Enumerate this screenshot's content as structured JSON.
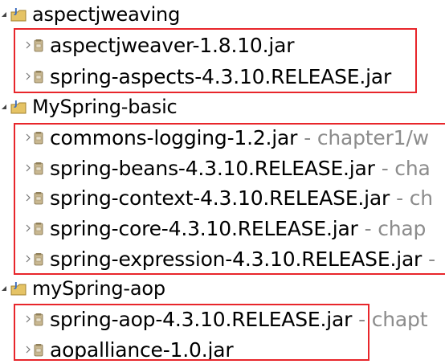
{
  "projects": [
    {
      "name": "aspectjweaving",
      "jars": [
        {
          "name": "aspectjweaver-1.8.10.jar",
          "decoration": ""
        },
        {
          "name": "spring-aspects-4.3.10.RELEASE.jar",
          "decoration": ""
        }
      ]
    },
    {
      "name": "MySpring-basic",
      "jars": [
        {
          "name": "commons-logging-1.2.jar",
          "decoration": "- chapter1/w"
        },
        {
          "name": "spring-beans-4.3.10.RELEASE.jar",
          "decoration": "- cha"
        },
        {
          "name": "spring-context-4.3.10.RELEASE.jar",
          "decoration": "- ch"
        },
        {
          "name": "spring-core-4.3.10.RELEASE.jar",
          "decoration": "- chap"
        },
        {
          "name": "spring-expression-4.3.10.RELEASE.jar",
          "decoration": "-"
        }
      ]
    },
    {
      "name": "mySpring-aop",
      "jars": [
        {
          "name": "spring-aop-4.3.10.RELEASE.jar",
          "decoration": "- chapt"
        },
        {
          "name": "aopalliance-1.0.jar",
          "decoration": ""
        }
      ]
    }
  ],
  "icons": {
    "expanded": "chevron-expanded-icon",
    "collapsed": "chevron-collapsed-icon",
    "project": "java-project-icon",
    "jar": "jar-icon"
  },
  "colors": {
    "highlight_border": "#e8262b",
    "decoration_text": "#8c8c8c"
  }
}
